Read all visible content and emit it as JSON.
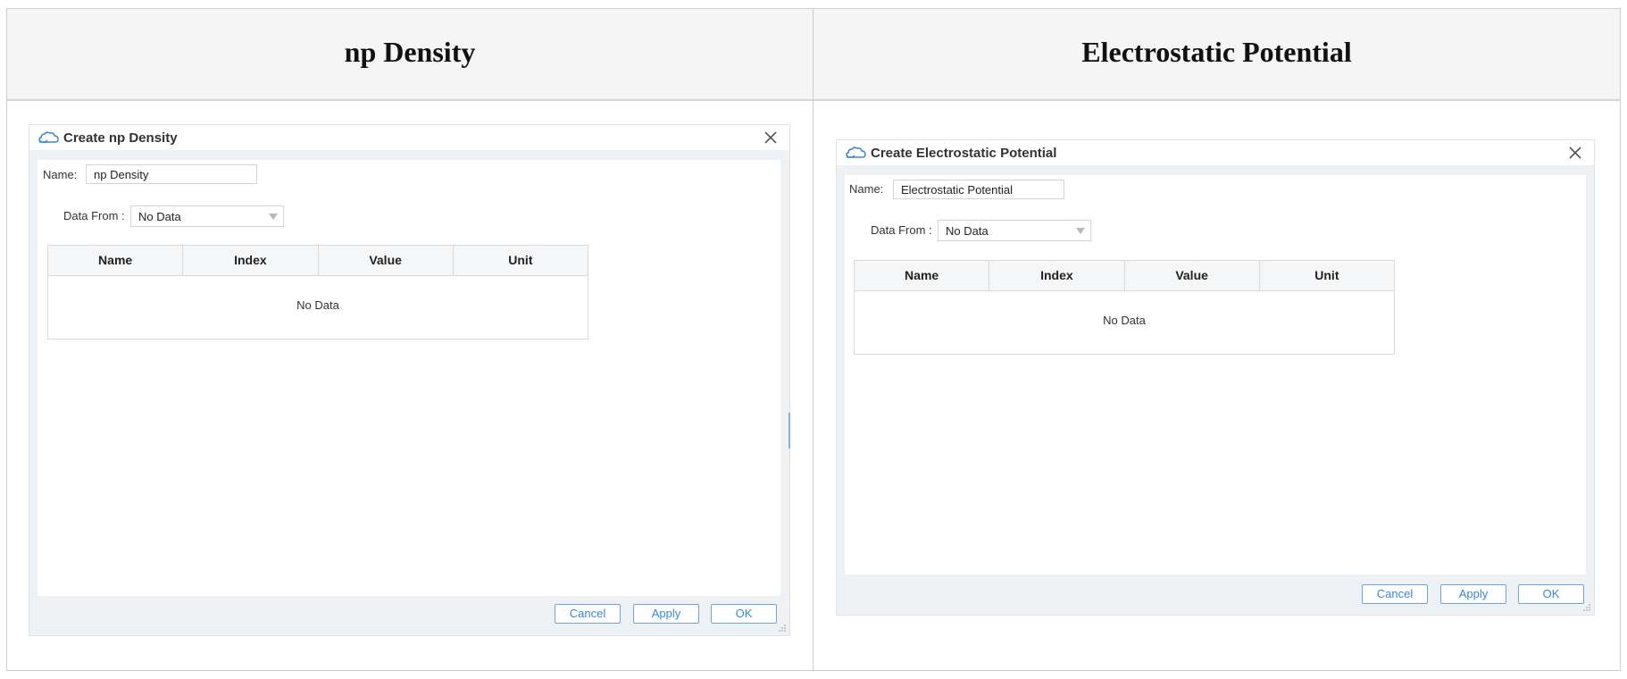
{
  "columns": [
    {
      "title": "np Density",
      "dialog": {
        "title": "Create np Density",
        "name_label": "Name:",
        "name_value": "np Density",
        "data_from_label": "Data From :",
        "data_from_value": "No Data",
        "table": {
          "headers": [
            "Name",
            "Index",
            "Value",
            "Unit"
          ],
          "empty_text": "No Data"
        },
        "buttons": {
          "cancel": "Cancel",
          "apply": "Apply",
          "ok": "OK"
        }
      }
    },
    {
      "title": "Electrostatic Potential",
      "dialog": {
        "title": "Create Electrostatic Potential",
        "name_label": "Name:",
        "name_value": "Electrostatic Potential",
        "data_from_label": "Data From :",
        "data_from_value": "No Data",
        "table": {
          "headers": [
            "Name",
            "Index",
            "Value",
            "Unit"
          ],
          "empty_text": "No Data"
        },
        "buttons": {
          "cancel": "Cancel",
          "apply": "Apply",
          "ok": "OK"
        }
      }
    }
  ],
  "icons": {
    "title_icon": "cloud-hand-icon",
    "close_icon": "close-icon",
    "dropdown_icon": "chevron-down-icon",
    "resize_icon": "resize-grip-icon"
  },
  "colors": {
    "accent": "#3a86d6",
    "dialog_bg": "#eff2f5",
    "header_band": "#f5f5f5"
  }
}
